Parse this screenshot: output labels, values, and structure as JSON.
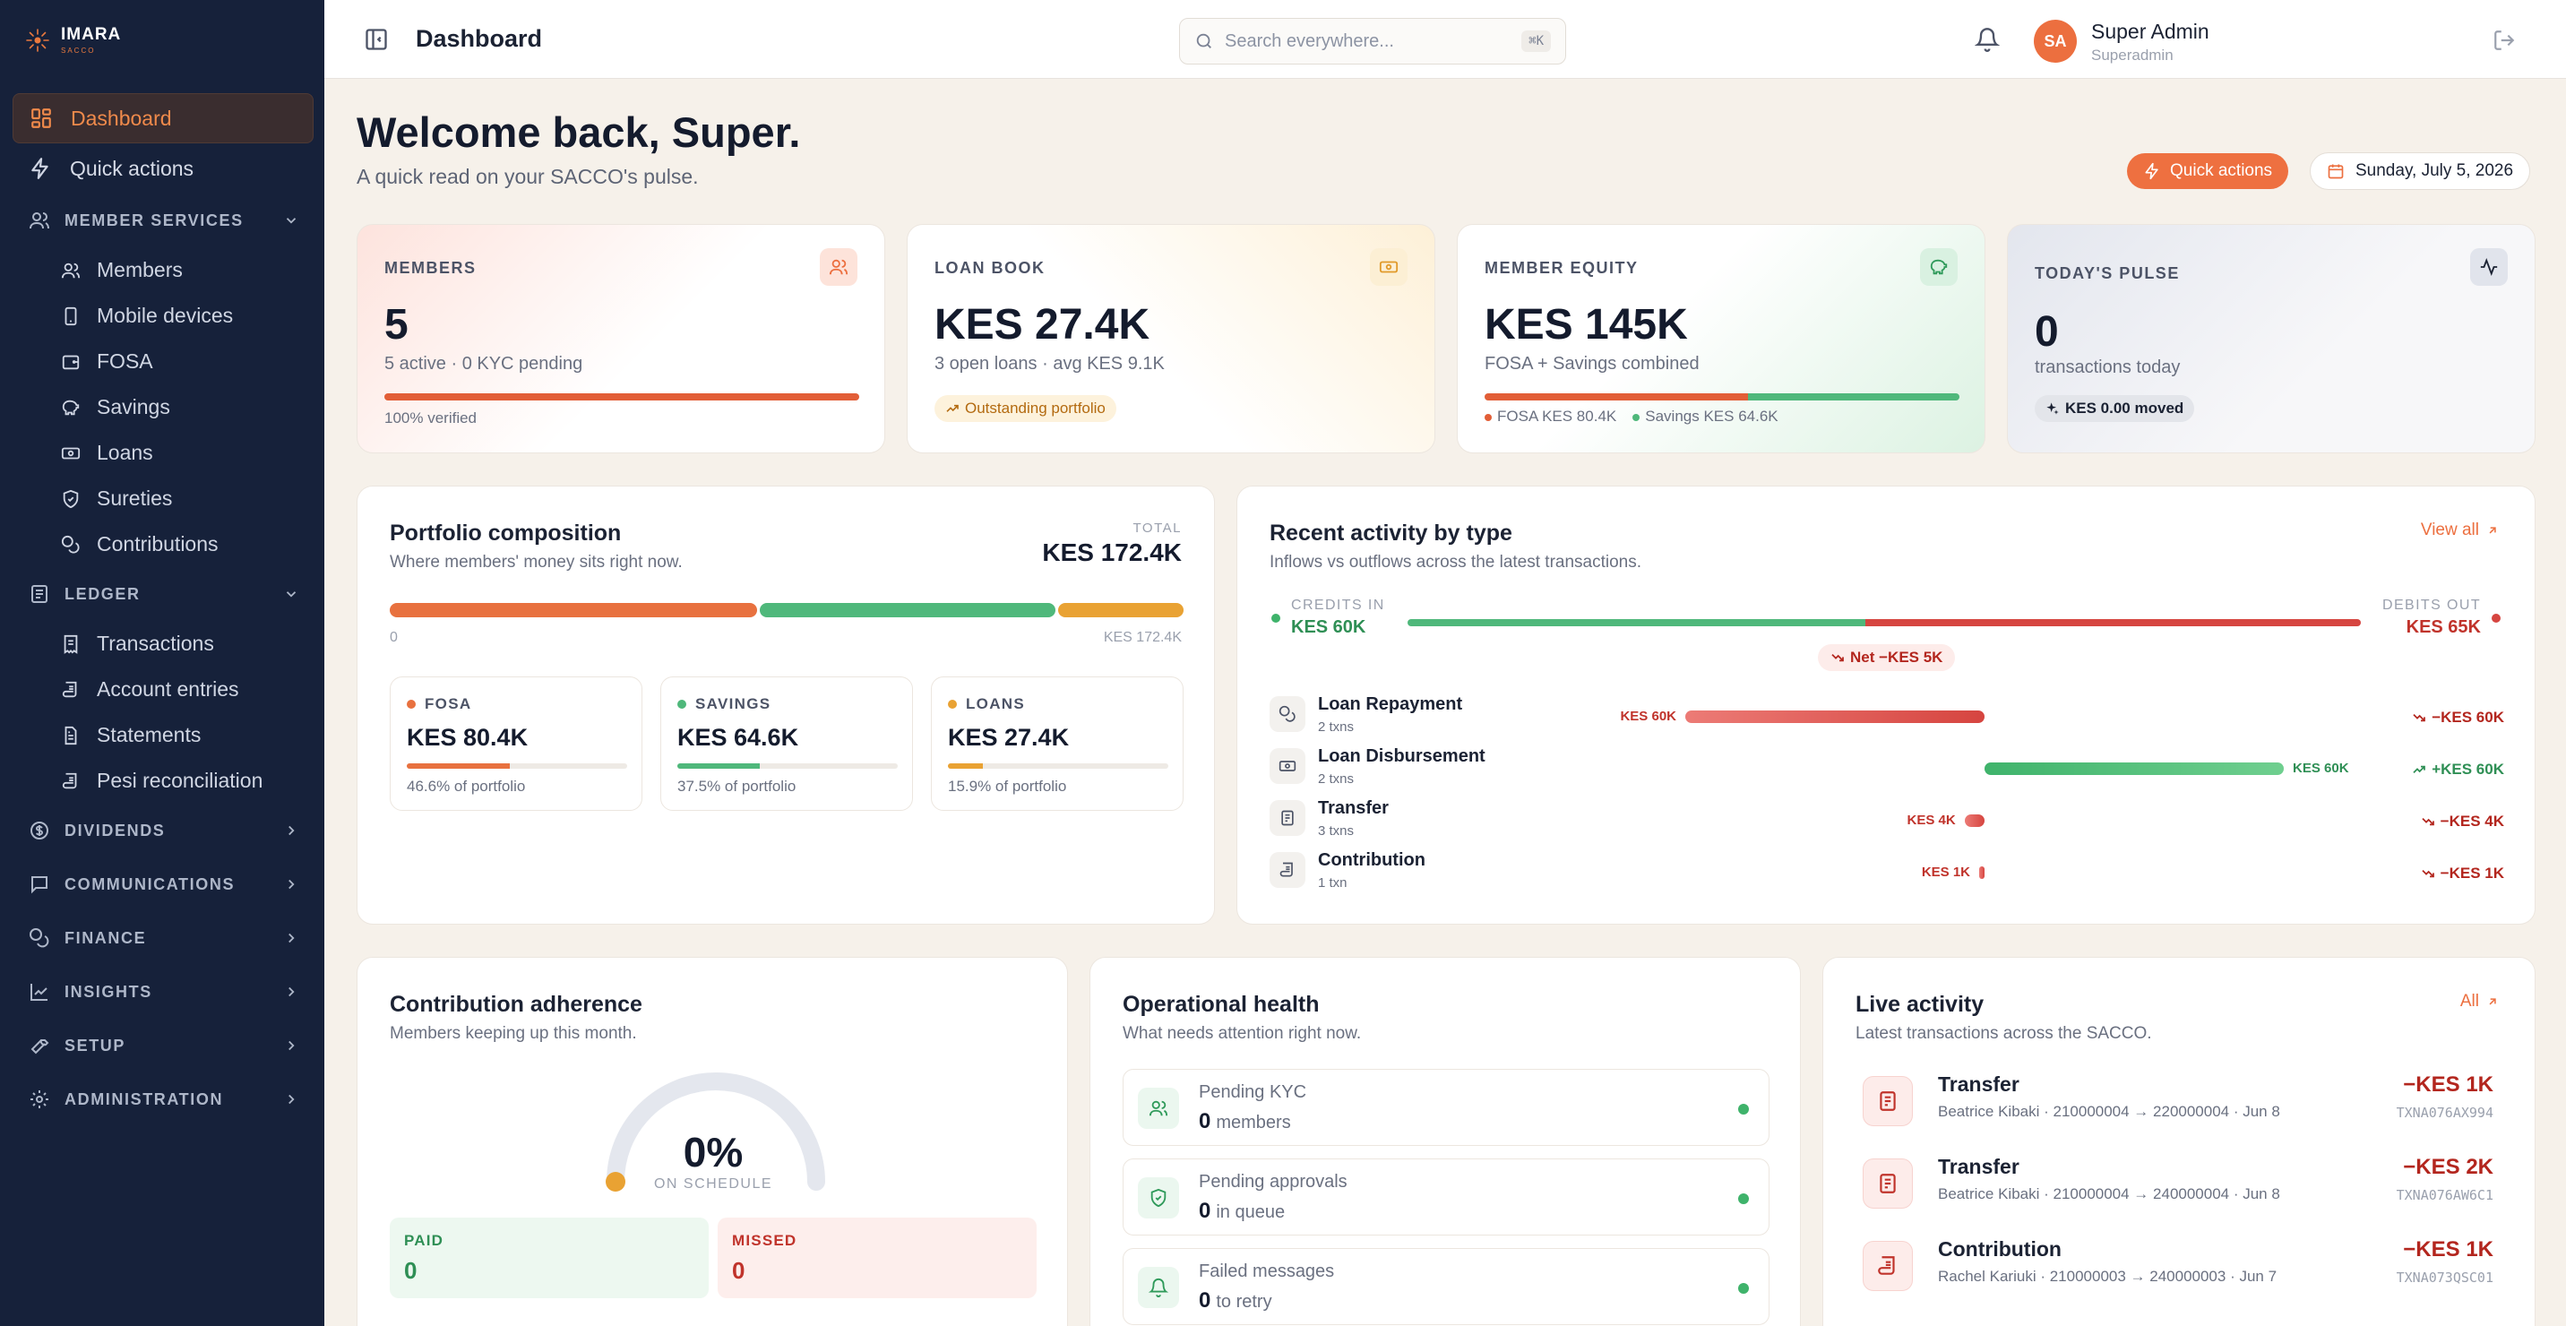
{
  "brand": {
    "name": "IMARA",
    "sub": "SACCO"
  },
  "sidebar": {
    "dashboard": "Dashboard",
    "quick_actions": "Quick actions",
    "member_services": {
      "label": "MEMBER SERVICES",
      "items": [
        "Members",
        "Mobile devices",
        "FOSA",
        "Savings",
        "Loans",
        "Sureties",
        "Contributions"
      ]
    },
    "ledger": {
      "label": "LEDGER",
      "items": [
        "Transactions",
        "Account entries",
        "Statements",
        "Pesi reconciliation"
      ]
    },
    "groups": [
      "DIVIDENDS",
      "COMMUNICATIONS",
      "FINANCE",
      "INSIGHTS",
      "SETUP",
      "ADMINISTRATION"
    ]
  },
  "topbar": {
    "title": "Dashboard",
    "search_placeholder": "Search everywhere...",
    "shortcut": "⌘K",
    "user_initials": "SA",
    "user_name": "Super Admin",
    "user_role": "Superadmin"
  },
  "header": {
    "welcome": "Welcome back, Super.",
    "subtitle": "A quick read on your SACCO's pulse.",
    "quick_actions": "Quick actions",
    "date": "Sunday, July 5, 2026"
  },
  "kpis": {
    "members": {
      "label": "MEMBERS",
      "value": "5",
      "sub": "5 active · 0 KYC pending",
      "progress": 1.0,
      "foot": "100% verified"
    },
    "loan_book": {
      "label": "LOAN BOOK",
      "value": "KES 27.4K",
      "sub": "3 open loans · avg KES 9.1K",
      "pill": "Outstanding portfolio"
    },
    "equity": {
      "label": "MEMBER EQUITY",
      "value": "KES 145K",
      "sub": "FOSA + Savings combined",
      "fosa_share": 0.555,
      "fosa": "FOSA KES 80.4K",
      "savings": "Savings KES 64.6K"
    },
    "pulse": {
      "label": "TODAY'S PULSE",
      "value": "0",
      "sub": "transactions today",
      "pill": "KES 0.00 moved"
    }
  },
  "portfolio": {
    "title": "Portfolio composition",
    "subtitle": "Where members' money sits right now.",
    "total_label": "TOTAL",
    "total": "KES 172.4K",
    "axis_min": "0",
    "axis_max": "KES 172.4K",
    "segments": [
      {
        "name": "FOSA",
        "value": "KES 80.4K",
        "share": 0.466,
        "pct": "46.6% of portfolio",
        "color": "#e8713f"
      },
      {
        "name": "SAVINGS",
        "value": "KES 64.6K",
        "share": 0.375,
        "pct": "37.5% of portfolio",
        "color": "#4fb87b"
      },
      {
        "name": "LOANS",
        "value": "KES 27.4K",
        "share": 0.159,
        "pct": "15.9% of portfolio",
        "color": "#e9a233"
      }
    ]
  },
  "recent": {
    "title": "Recent activity by type",
    "subtitle": "Inflows vs outflows across the latest transactions.",
    "view_all": "View all",
    "credits_label": "CREDITS IN",
    "credits": "KES 60K",
    "debits_label": "DEBITS OUT",
    "debits": "KES 65K",
    "credit_share": 0.48,
    "net": "Net −KES 5K",
    "rows": [
      {
        "name": "Loan Repayment",
        "count": "2 txns",
        "amount": 60,
        "dir": "out",
        "label": "KES 60K",
        "net": "−KES 60K"
      },
      {
        "name": "Loan Disbursement",
        "count": "2 txns",
        "amount": 60,
        "dir": "in",
        "label": "KES 60K",
        "net": "+KES 60K"
      },
      {
        "name": "Transfer",
        "count": "3 txns",
        "amount": 4,
        "dir": "out",
        "label": "KES 4K",
        "net": "−KES 4K"
      },
      {
        "name": "Contribution",
        "count": "1 txn",
        "amount": 1,
        "dir": "out",
        "label": "KES 1K",
        "net": "−KES 1K"
      }
    ]
  },
  "contribution": {
    "title": "Contribution adherence",
    "subtitle": "Members keeping up this month.",
    "value": "0%",
    "value_num": 0,
    "caption": "ON SCHEDULE",
    "paid_label": "PAID",
    "paid": "0",
    "missed_label": "MISSED",
    "missed": "0"
  },
  "operational": {
    "title": "Operational health",
    "subtitle": "What needs attention right now.",
    "rows": [
      {
        "label": "Pending KYC",
        "value": "0",
        "unit": "members"
      },
      {
        "label": "Pending approvals",
        "value": "0",
        "unit": "in queue"
      },
      {
        "label": "Failed messages",
        "value": "0",
        "unit": "to retry"
      }
    ]
  },
  "live": {
    "title": "Live activity",
    "subtitle": "Latest transactions across the SACCO.",
    "all": "All",
    "rows": [
      {
        "type": "Transfer",
        "detail": "Beatrice Kibaki · 210000004 → 220000004 · Jun 8",
        "amount": "−KES 1K",
        "ref": "TXNA076AX994"
      },
      {
        "type": "Transfer",
        "detail": "Beatrice Kibaki · 210000004 → 240000004 · Jun 8",
        "amount": "−KES 2K",
        "ref": "TXNA076AW6C1"
      },
      {
        "type": "Contribution",
        "detail": "Rachel Kariuki · 210000003 → 240000003 · Jun 7",
        "amount": "−KES 1K",
        "ref": "TXNA073QSC01"
      }
    ]
  },
  "colors": {
    "accent": "#ec6f3f",
    "green": "#4fb87b",
    "red": "#d64540",
    "amber": "#e9a233",
    "sidebar": "#16213a"
  }
}
